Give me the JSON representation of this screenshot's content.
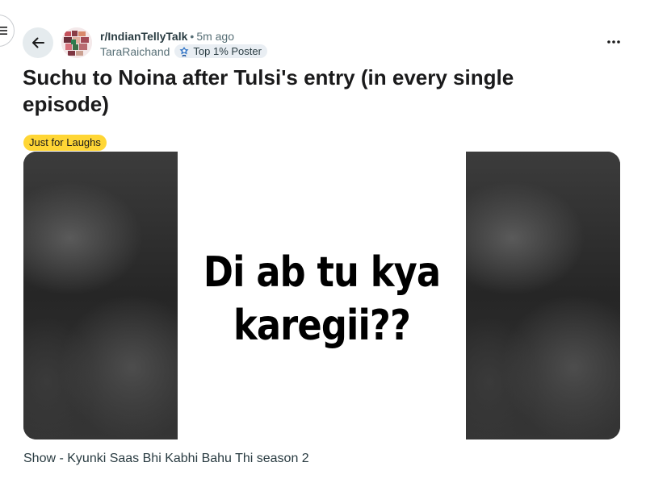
{
  "post": {
    "subreddit": "r/IndianTellyTalk",
    "separator": "•",
    "time_ago": "5m ago",
    "author": "TaraRaichand",
    "author_badge": "Top 1% Poster",
    "title": "Suchu to Noina after Tulsi's entry (in every single episode)",
    "flair": "Just for Laughs",
    "image_text_line1": "Di ab tu kya",
    "image_text_line2": "karegii??",
    "body": "Show - Kyunki Saas Bhi Kabhi Bahu Thi season 2"
  },
  "icons": {
    "menu": "hamburger-menu-icon",
    "back": "arrow-left-icon",
    "badge": "top-poster-badge-icon",
    "more": "more-horizontal-icon"
  },
  "colors": {
    "flair_bg": "#ffd635",
    "back_button_bg": "#e5ebee",
    "badge_bg": "#e9eef3",
    "meta_text": "#576f76"
  }
}
